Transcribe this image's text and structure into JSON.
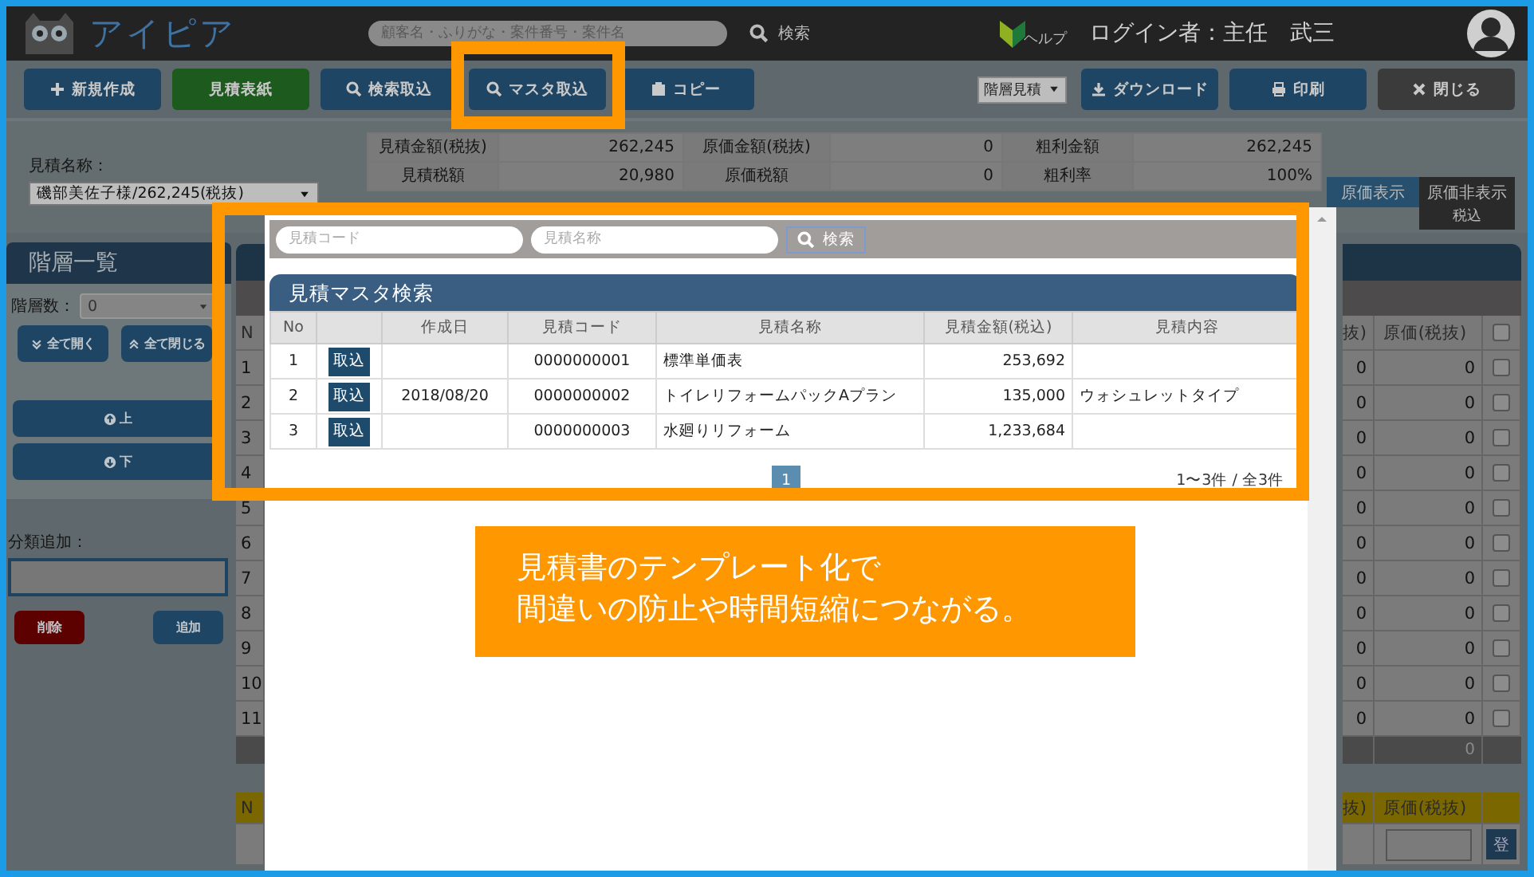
{
  "header": {
    "logo": "アイピア",
    "search": {
      "placeholder": "顧客名・ふりがな・案件番号・案件名"
    },
    "search_button": "検索",
    "help": "ヘルプ",
    "login": "ログイン者：主任　武三"
  },
  "toolbar": {
    "buttons": [
      {
        "label": "新規作成",
        "kind": "primary"
      },
      {
        "label": "見積表紙",
        "kind": "success"
      },
      {
        "label": "検索取込",
        "kind": "primary"
      },
      {
        "label": "マスタ取込",
        "kind": "primary"
      },
      {
        "label": "コピー",
        "kind": "primary"
      }
    ],
    "view_select": "階層見積",
    "right_buttons": [
      {
        "label": "ダウンロード",
        "kind": "primary"
      },
      {
        "label": "印刷",
        "kind": "primary"
      },
      {
        "label": "閉じる",
        "kind": "dark"
      }
    ]
  },
  "summary": {
    "name_label": "見積名称：",
    "name_select": "磯部美佐子様/262,245(税抜)",
    "rows": [
      [
        {
          "label": "見積金額(税抜)",
          "value": "262,245"
        },
        {
          "label": "原価金額(税抜)",
          "value": "0"
        },
        {
          "label": "粗利金額",
          "value": "262,245"
        }
      ],
      [
        {
          "label": "見積税額",
          "value": "20,980"
        },
        {
          "label": "原価税額",
          "value": "0"
        },
        {
          "label": "粗利率",
          "value": "100%"
        }
      ]
    ],
    "cost_toggle": [
      {
        "label": "原価表示",
        "selected": true
      },
      {
        "label": "原価非表示",
        "selected": false
      }
    ],
    "tax_mode": "税込"
  },
  "tree": {
    "title": "階層一覧",
    "depth_label": "階層数：",
    "depth_value": "0",
    "expand_all": "全て開く",
    "collapse_all": "全て閉じる",
    "up": "上",
    "down": "下",
    "add_label": "分類追加：",
    "delete": "削除",
    "add": "追加"
  },
  "detail": {
    "no_header": "N",
    "column_2_header": "抜)",
    "cost_header": "原価(税抜)",
    "all_checked": false,
    "rows": [
      {
        "no": "1",
        "column_2": "0",
        "cost": "0",
        "checked": false
      },
      {
        "no": "2",
        "column_2": "0",
        "cost": "0",
        "checked": false
      },
      {
        "no": "3",
        "column_2": "0",
        "cost": "0",
        "checked": false
      },
      {
        "no": "4",
        "column_2": "0",
        "cost": "0",
        "checked": false
      },
      {
        "no": "5",
        "column_2": "0",
        "cost": "0",
        "checked": false
      },
      {
        "no": "6",
        "column_2": "0",
        "cost": "0",
        "checked": false
      },
      {
        "no": "7",
        "column_2": "0",
        "cost": "0",
        "checked": false
      },
      {
        "no": "8",
        "column_2": "0",
        "cost": "0",
        "checked": false
      },
      {
        "no": "9",
        "column_2": "0",
        "cost": "0",
        "checked": false
      },
      {
        "no": "10",
        "column_2": "0",
        "cost": "0",
        "checked": false
      },
      {
        "no": "11",
        "column_2": "0",
        "cost": "0",
        "checked": false
      }
    ],
    "total": "0",
    "entry": {
      "no_header": "N",
      "column_2_header": "抜)",
      "cost_header": "原価(税抜)",
      "register": "登"
    }
  },
  "modal": {
    "search": [
      {
        "placeholder": "見積コード"
      },
      {
        "placeholder": "見積名称"
      }
    ],
    "search_button": "検索",
    "title": "見積マスタ検索",
    "columns": [
      "No",
      "作成日",
      "見積コード",
      "見積名称",
      "見積金額(税込)",
      "見積内容"
    ],
    "rows": [
      {
        "no": "1",
        "action": "取込",
        "code": "0000000001",
        "name": "標準単価表",
        "amount": "253,692"
      },
      {
        "no": "2",
        "action": "取込",
        "date": "2018/08/20",
        "code": "0000000002",
        "name": "トイレリフォームパックAプラン",
        "amount": "135,000",
        "content": "ウォシュレットタイプ"
      },
      {
        "no": "3",
        "action": "取込",
        "code": "0000000003",
        "name": "水廻りリフォーム",
        "amount": "1,233,684"
      }
    ],
    "pages": [
      {
        "label": "1",
        "selected": true
      }
    ],
    "count": "1〜3件 / 全3件"
  },
  "callout": {
    "lines": [
      "見積書のテンプレート化で",
      "間違いの防止や時間短縮につながる。"
    ]
  }
}
